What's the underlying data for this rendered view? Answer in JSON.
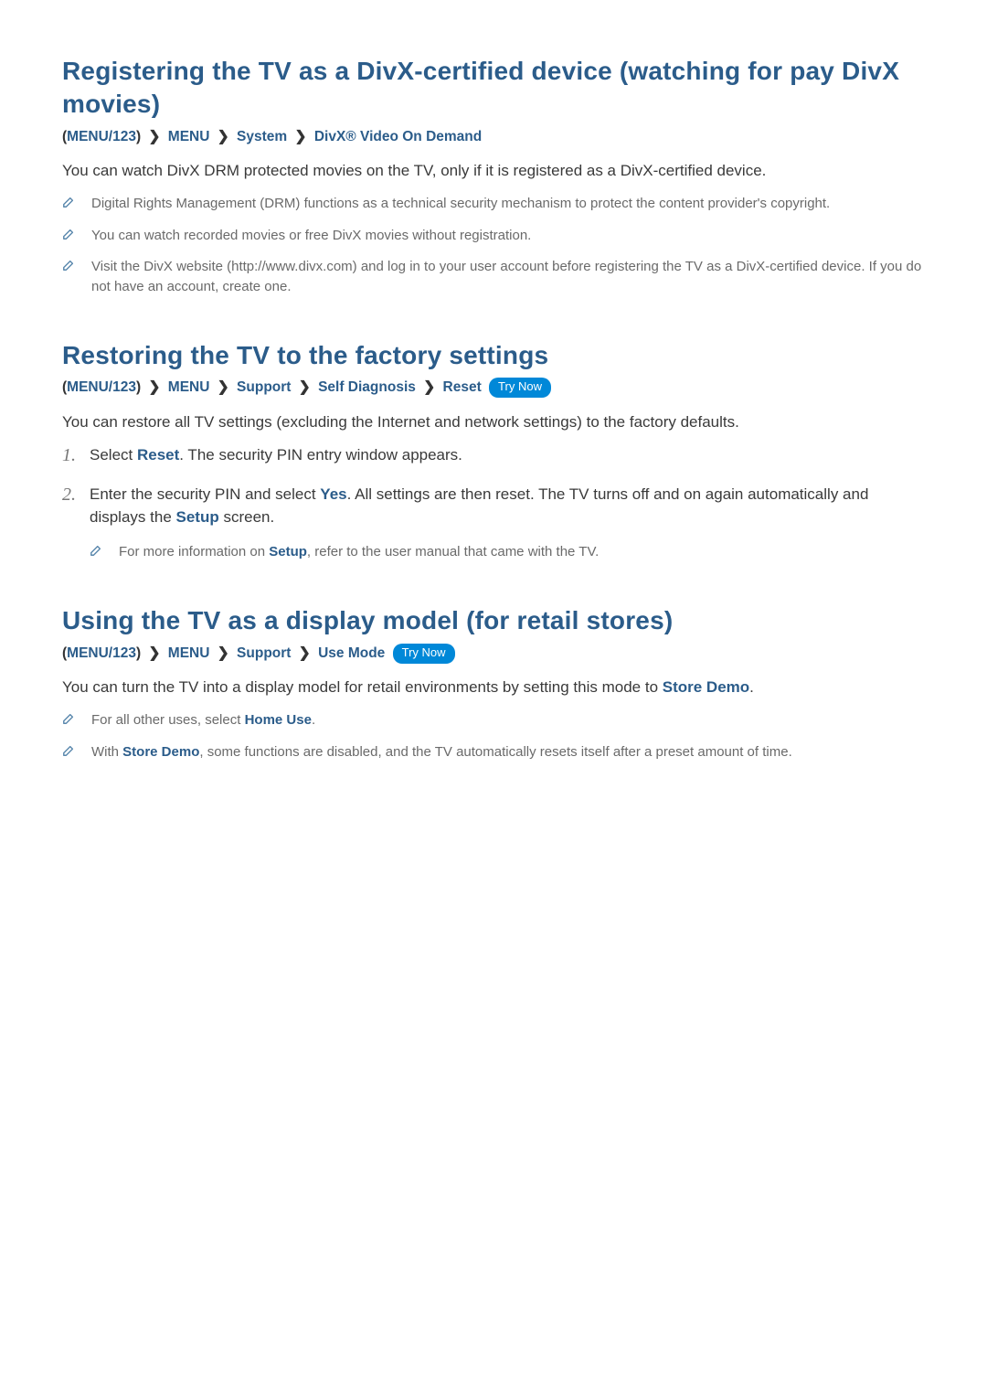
{
  "section1": {
    "title": "Registering the TV as a DivX-certified device (watching for pay DivX movies)",
    "bc": {
      "p0a": "(",
      "p0b": "MENU/123",
      "p0c": ")",
      "p1": "MENU",
      "p2": "System",
      "p3": "DivX® Video On Demand"
    },
    "intro": "You can watch DivX DRM protected movies on the TV, only if it is registered as a DivX-certified device.",
    "notes": [
      "Digital Rights Management (DRM) functions as a technical security mechanism to protect the content provider's copyright.",
      "You can watch recorded movies or free DivX movies without registration.",
      "Visit the DivX website (http://www.divx.com) and log in to your user account before registering the TV as a DivX-certified device. If you do not have an account, create one."
    ]
  },
  "section2": {
    "title": "Restoring the TV to the factory settings",
    "bc": {
      "p0a": "(",
      "p0b": "MENU/123",
      "p0c": ")",
      "p1": "MENU",
      "p2": "Support",
      "p3": "Self Diagnosis",
      "p4": "Reset"
    },
    "trynow": "Try Now",
    "intro": "You can restore all TV settings (excluding the Internet and network settings) to the factory defaults.",
    "step1_a": "Select ",
    "step1_hl": "Reset",
    "step1_b": ". The security PIN entry window appears.",
    "step2_a": "Enter the security PIN and select ",
    "step2_hl1": "Yes",
    "step2_b": ". All settings are then reset. The TV turns off and on again automatically and displays the ",
    "step2_hl2": "Setup",
    "step2_c": " screen.",
    "subnote_a": "For more information on ",
    "subnote_hl": "Setup",
    "subnote_b": ", refer to the user manual that came with the TV."
  },
  "section3": {
    "title": "Using the TV as a display model (for retail stores)",
    "bc": {
      "p0a": "(",
      "p0b": "MENU/123",
      "p0c": ")",
      "p1": "MENU",
      "p2": "Support",
      "p3": "Use Mode"
    },
    "trynow": "Try Now",
    "intro_a": "You can turn the TV into a display model for retail environments by setting this mode to ",
    "intro_hl": "Store Demo",
    "intro_b": ".",
    "note1_a": "For all other uses, select ",
    "note1_hl": "Home Use",
    "note1_b": ".",
    "note2_a": "With ",
    "note2_hl": "Store Demo",
    "note2_b": ", some functions are disabled, and the TV automatically resets itself after a preset amount of time."
  }
}
